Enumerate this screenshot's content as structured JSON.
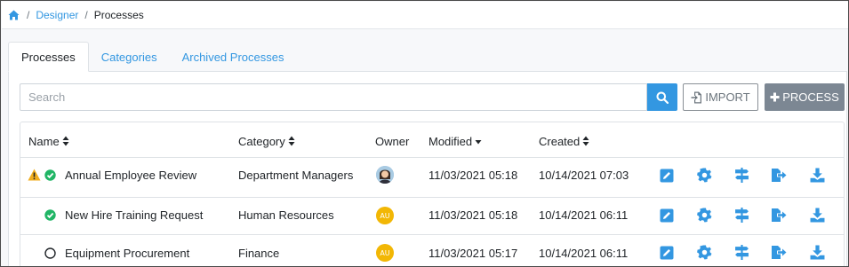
{
  "breadcrumb": {
    "home_icon": "home-icon",
    "items": [
      {
        "label": "Designer",
        "link": true
      },
      {
        "label": "Processes",
        "link": false
      }
    ],
    "separator": "/"
  },
  "tabs": [
    {
      "label": "Processes",
      "active": true
    },
    {
      "label": "Categories",
      "active": false
    },
    {
      "label": "Archived Processes",
      "active": false
    }
  ],
  "search": {
    "placeholder": "Search",
    "value": "",
    "button_icon": "search-icon"
  },
  "toolbar": {
    "import_label": "IMPORT",
    "import_icon": "file-import-icon",
    "process_label": "PROCESS",
    "process_icon": "plus-icon"
  },
  "table": {
    "columns": [
      {
        "label": "Name",
        "sort": "both"
      },
      {
        "label": "Category",
        "sort": "both"
      },
      {
        "label": "Owner",
        "sort": "none"
      },
      {
        "label": "Modified",
        "sort": "desc"
      },
      {
        "label": "Created",
        "sort": "both"
      }
    ],
    "rows": [
      {
        "warning": true,
        "status": "active",
        "name": "Annual Employee Review",
        "category": "Department Managers",
        "owner": "photo",
        "modified": "11/03/2021 05:18",
        "created": "10/14/2021 07:03"
      },
      {
        "warning": false,
        "status": "active",
        "name": "New Hire Training Request",
        "category": "Human Resources",
        "owner": "AU",
        "modified": "11/03/2021 05:18",
        "created": "10/14/2021 06:11"
      },
      {
        "warning": false,
        "status": "inactive",
        "name": "Equipment Procurement",
        "category": "Finance",
        "owner": "AU",
        "modified": "11/03/2021 05:17",
        "created": "10/14/2021 06:11"
      }
    ],
    "row_actions": [
      "edit-icon",
      "gear-icon",
      "signpost-icon",
      "export-icon",
      "download-icon"
    ]
  },
  "colors": {
    "accent": "#3397e1",
    "success": "#28a745",
    "warning": "#f0ad1e",
    "secondary_button": "#7c8793",
    "avatar": "#f2b705"
  }
}
